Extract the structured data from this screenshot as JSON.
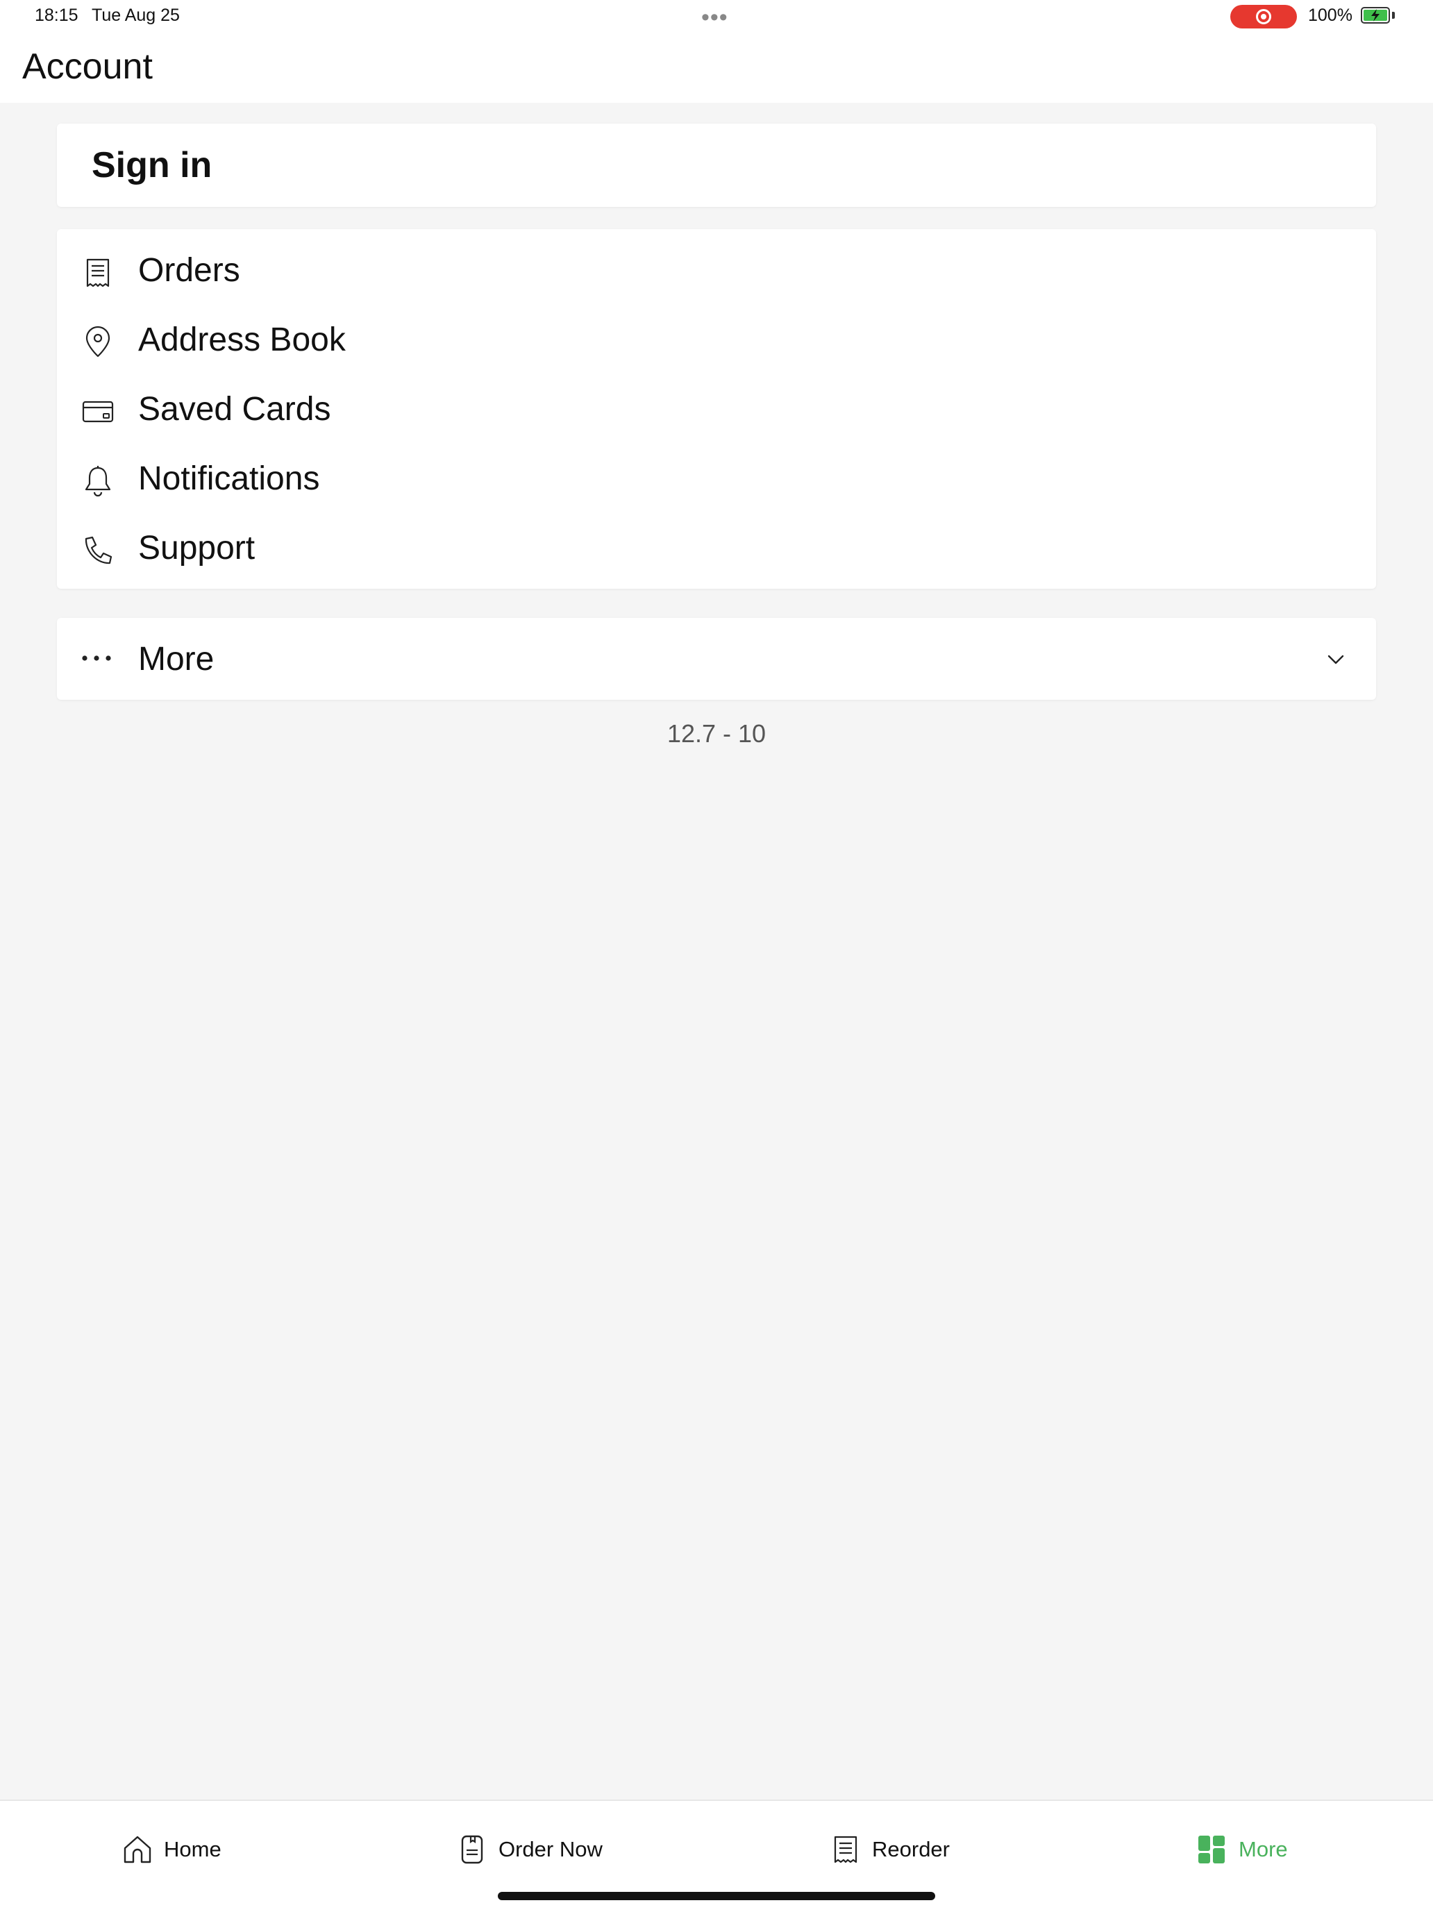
{
  "status_bar": {
    "time": "18:15",
    "date": "Tue Aug 25",
    "center_dots": "•••",
    "battery_percent": "100%",
    "recording_color": "#e6382f",
    "battery_color": "#3fbf4b"
  },
  "header": {
    "title": "Account"
  },
  "sign_in": {
    "label": "Sign in"
  },
  "menu": {
    "items": [
      {
        "label": "Orders",
        "icon": "receipt-icon"
      },
      {
        "label": "Address Book",
        "icon": "location-pin-icon"
      },
      {
        "label": "Saved Cards",
        "icon": "credit-card-icon"
      },
      {
        "label": "Notifications",
        "icon": "bell-icon"
      },
      {
        "label": "Support",
        "icon": "phone-icon"
      }
    ]
  },
  "more_section": {
    "label": "More",
    "icon": "ellipsis-icon",
    "expand_icon": "chevron-down-icon"
  },
  "version": "12.7 - 10",
  "tab_bar": {
    "accent_color": "#49b25c",
    "tabs": [
      {
        "label": "Home",
        "icon": "home-icon",
        "active": false
      },
      {
        "label": "Order Now",
        "icon": "menu-document-icon",
        "active": false
      },
      {
        "label": "Reorder",
        "icon": "receipt-icon",
        "active": false
      },
      {
        "label": "More",
        "icon": "grid-icon",
        "active": true
      }
    ]
  }
}
